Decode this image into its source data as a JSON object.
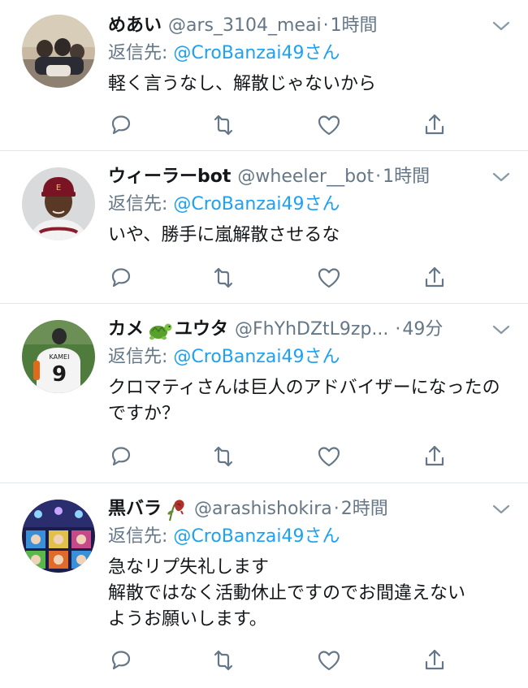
{
  "reply_prefix": "返信先: ",
  "tweets": [
    {
      "display_name": "めあい",
      "handle": "@ars_3104_meai",
      "separator": "·",
      "time": "1時間",
      "reply_to": "@CroBanzai49さん",
      "text": "軽く言うなし、解散じゃないから",
      "avatar_icon": "group-photo-avatar"
    },
    {
      "display_name": "ウィーラーbot",
      "handle": "@wheeler__bot",
      "separator": "·",
      "time": "1時間",
      "reply_to": "@CroBanzai49さん",
      "text": "いや、勝手に嵐解散させるな",
      "avatar_icon": "baseball-player-avatar"
    },
    {
      "display_name": "カメ",
      "name_emoji": "turtle-emoji",
      "display_name_suffix": "ユウタ",
      "handle": "@FhYhDZtL9zp...",
      "separator": "·",
      "time": "49分",
      "reply_to": "@CroBanzai49さん",
      "text": "クロマティさんは巨人のアドバイザーになったのですか？",
      "avatar_icon": "jersey-9-avatar"
    },
    {
      "display_name": "黒バラ",
      "name_emoji": "wilted-rose-emoji",
      "handle": "@arashishokira",
      "separator": "·",
      "time": "2時間",
      "reply_to": "@CroBanzai49さん",
      "text": "急なリプ失礼します\n解散ではなく活動休止ですのでお間違えない\nようお願いします。",
      "avatar_icon": "collage-avatar"
    }
  ],
  "icons": {
    "reply": "reply-icon",
    "retweet": "retweet-icon",
    "like": "heart-icon",
    "share": "share-icon",
    "more": "chevron-down-icon"
  },
  "colors": {
    "link": "#1da1f2",
    "secondary": "#657786",
    "text": "#14171a",
    "divider": "#e1e8ed",
    "icon": "#657786"
  }
}
